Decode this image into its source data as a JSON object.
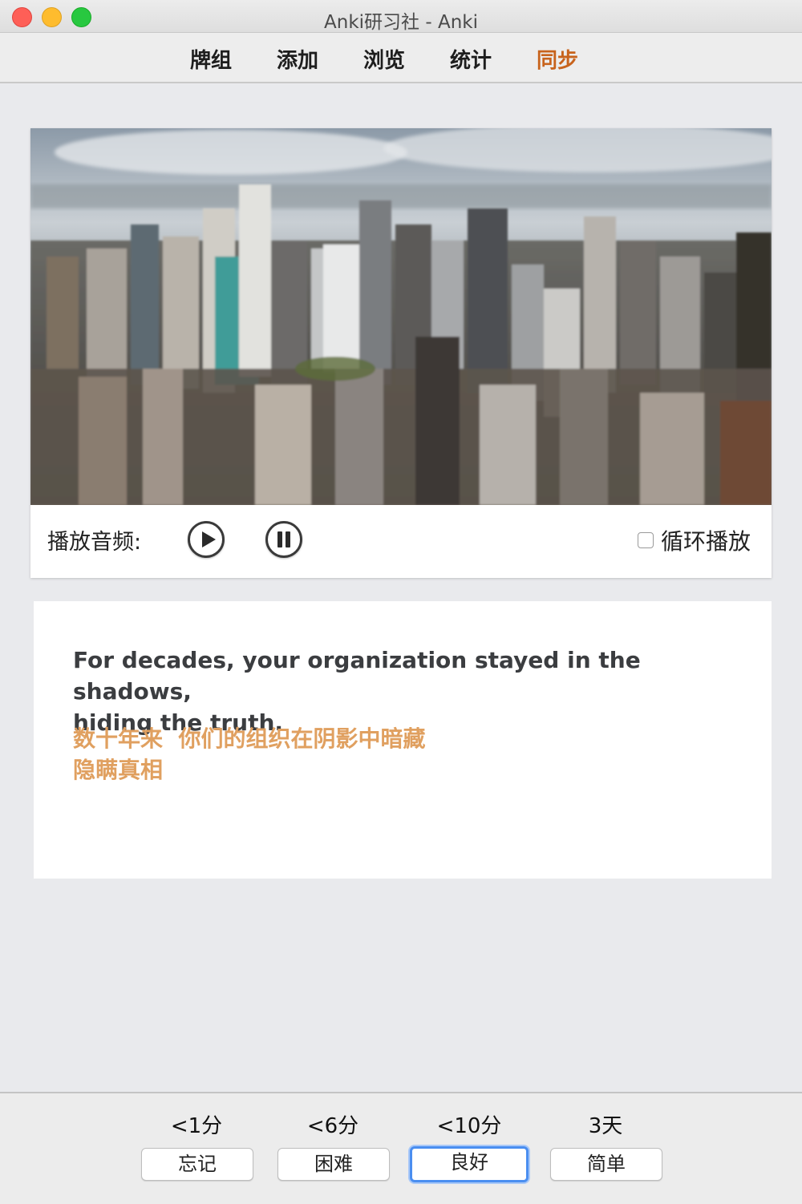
{
  "window": {
    "title": "Anki研习社 - Anki"
  },
  "toolbar": {
    "items": [
      {
        "label": "牌组"
      },
      {
        "label": "添加"
      },
      {
        "label": "浏览"
      },
      {
        "label": "统计"
      },
      {
        "label": "同步"
      }
    ],
    "sync_color": "#c8631c"
  },
  "media": {
    "audio_label": "播放音频:",
    "play_icon": "play-circle-icon",
    "pause_icon": "pause-circle-icon",
    "loop_label": "循环播放",
    "loop_checked": false
  },
  "card": {
    "english_line1": "For decades, your organization stayed in the shadows,",
    "english_line2": "hiding the truth.",
    "chinese_line1": "数十年来  你们的组织在阴影中暗藏",
    "chinese_line2": "隐瞒真相",
    "chinese_color": "#e0a060"
  },
  "answers": [
    {
      "interval": "<1分",
      "label": "忘记"
    },
    {
      "interval": "<6分",
      "label": "困难"
    },
    {
      "interval": "<10分",
      "label": "良好",
      "focused": true
    },
    {
      "interval": "3天",
      "label": "简单"
    }
  ]
}
